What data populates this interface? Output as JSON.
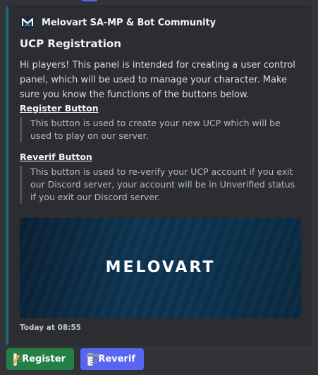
{
  "embed": {
    "author": {
      "name": "Melovart SA-MP & Bot Community",
      "icon_glyph": "M",
      "icon_name": "melovart-logo-icon"
    },
    "title": "UCP Registration",
    "description": "Hi players! This panel is intended for creating a user control panel, which will be used to manage your character. Make sure you know the functions of the buttons below.",
    "fields": [
      {
        "name": "Register Button",
        "value": "This button is used to create your new UCP which will be used to play on our server."
      },
      {
        "name": "Reverif Button",
        "value": "This button is used to re-verify your UCP account if you exit our Discord server, your account will be in Unverified status if you exit our Discord server."
      }
    ],
    "banner_text": "MELOVART",
    "footer": "Today at 08:55",
    "accent_color": "#1a6578"
  },
  "buttons": [
    {
      "label": "Register",
      "emoji": "memo-icon",
      "color": "#248046"
    },
    {
      "label": "Reverif",
      "emoji": "calendar-icon",
      "color": "#5865f2"
    }
  ]
}
